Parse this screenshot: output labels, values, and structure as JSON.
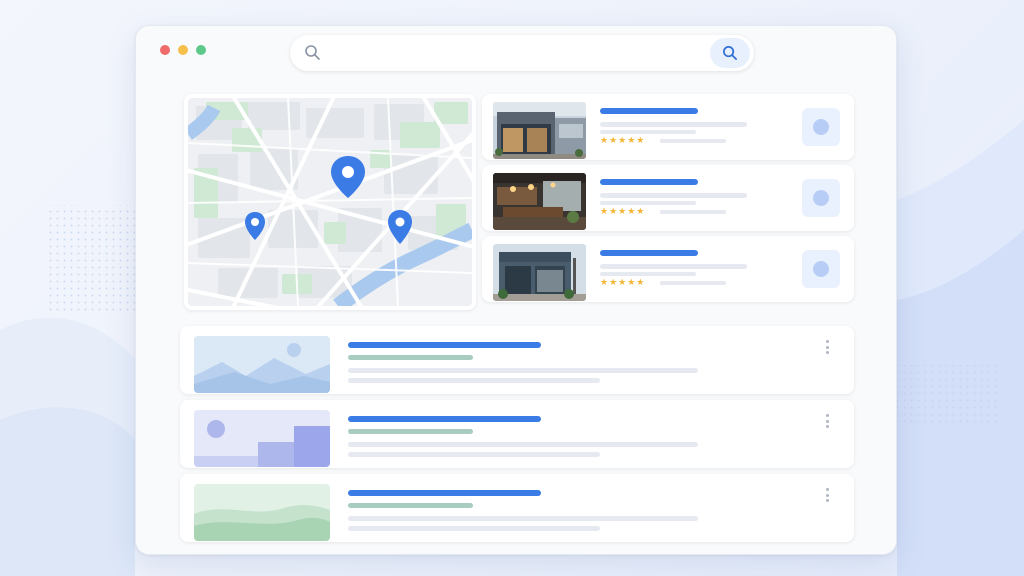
{
  "search": {
    "value": "",
    "placeholder": ""
  },
  "colors": {
    "accent": "#3b7be6",
    "star": "#f3b637",
    "pin": "#3b7be6",
    "window_dot_red": "#f06a6a",
    "window_dot_yellow": "#f5c04a",
    "window_dot_green": "#5cc98a"
  },
  "icons": {
    "search": "search-icon",
    "pin": "map-pin-icon",
    "more": "more-vertical-icon"
  },
  "places": [
    {
      "stars": "★★★★★",
      "image": "storefront-photo"
    },
    {
      "stars": "★★★★★",
      "image": "restaurant-interior-photo"
    },
    {
      "stars": "★★★★★",
      "image": "storefront-photo"
    }
  ],
  "results": [
    {
      "image": "mountain-landscape-placeholder"
    },
    {
      "image": "bar-graphic-placeholder"
    },
    {
      "image": "green-hills-placeholder"
    }
  ]
}
